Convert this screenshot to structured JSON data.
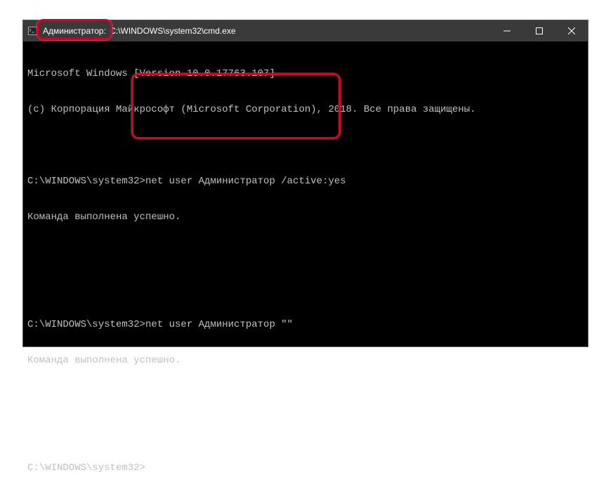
{
  "window": {
    "title_admin": "Администратор:",
    "title_path": "C:\\WINDOWS\\system32\\cmd.exe"
  },
  "terminal": {
    "line1": "Microsoft Windows [Version 10.0.17763.107]",
    "line2": "(c) Корпорация Майкрософт (Microsoft Corporation), 2018. Все права защищены.",
    "blank1": "",
    "prompt1": "C:\\WINDOWS\\system32>net user Администратор /active:yes",
    "result1": "Команда выполнена успешно.",
    "blank2": "",
    "blank3": "",
    "prompt2": "C:\\WINDOWS\\system32>net user Администратор \"\"",
    "result2": "Команда выполнена успешно.",
    "blank4": "",
    "blank5": "",
    "prompt3": "C:\\WINDOWS\\system32>"
  },
  "icons": {
    "app": "cmd-icon",
    "minimize": "minimize-icon",
    "maximize": "maximize-icon",
    "close": "close-icon"
  },
  "highlights": {
    "h1": "title-admin-highlight",
    "h2": "commands-highlight"
  }
}
